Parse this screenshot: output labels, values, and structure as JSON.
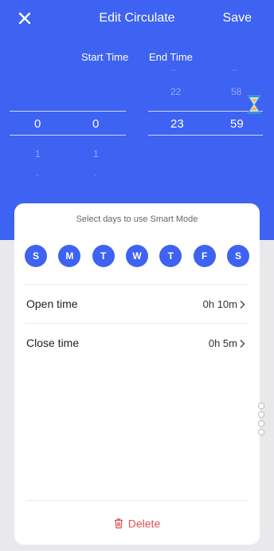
{
  "header": {
    "title": "Edit Circulate",
    "save_label": "Save"
  },
  "picker": {
    "start_label": "Start Time",
    "end_label": "End Time",
    "start_hour": {
      "above": "",
      "selected": "0",
      "below": "1",
      "below2": "-"
    },
    "start_minute": {
      "above": "",
      "selected": "0",
      "below": "1",
      "below2": "-"
    },
    "end_hour": {
      "above2": "--",
      "above": "22",
      "selected": "23",
      "below": ""
    },
    "end_minute": {
      "above2": "--",
      "above": "58",
      "selected": "59",
      "below": ""
    }
  },
  "smart_mode": {
    "caption": "Select days to use Smart Mode",
    "days": [
      "S",
      "M",
      "T",
      "W",
      "T",
      "F",
      "S"
    ]
  },
  "settings": {
    "open_time": {
      "label": "Open time",
      "value": "0h 10m"
    },
    "close_time": {
      "label": "Close time",
      "value": "0h 5m"
    }
  },
  "footer": {
    "delete_label": "Delete"
  },
  "icons": {
    "close": "close-icon",
    "hourglass": "hourglass-icon",
    "chevron": "chevron-right-icon",
    "trash": "trash-icon",
    "handle": "drag-handle-icon"
  },
  "colors": {
    "accent": "#3e62f2",
    "danger": "#e05252",
    "card": "#ffffff",
    "background": "#e9e9ec"
  }
}
